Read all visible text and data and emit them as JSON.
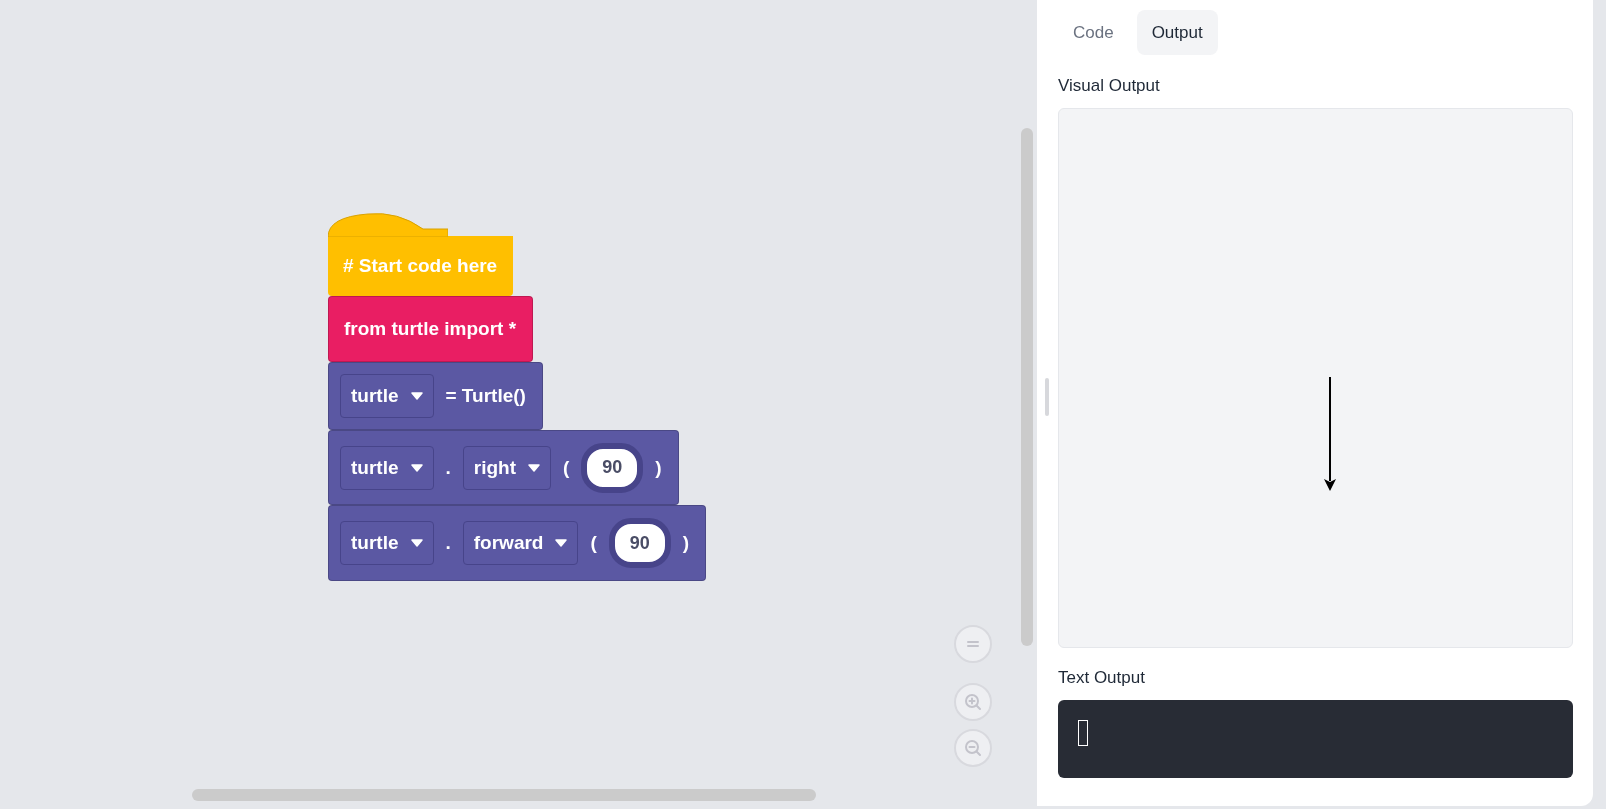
{
  "workspace": {
    "blocks": [
      {
        "kind": "hat",
        "color": "#ffbf00",
        "parts": [
          {
            "kind": "text",
            "text": "# Start code here"
          }
        ]
      },
      {
        "kind": "statement",
        "color": "#e91e63",
        "parts": [
          {
            "kind": "text",
            "text": "from turtle import *"
          }
        ]
      },
      {
        "kind": "statement",
        "color": "#5b58a3",
        "parts": [
          {
            "kind": "dropdown",
            "text": "turtle"
          },
          {
            "kind": "text",
            "text": "= Turtle()"
          }
        ]
      },
      {
        "kind": "statement",
        "color": "#5b58a3",
        "parts": [
          {
            "kind": "dropdown",
            "text": "turtle"
          },
          {
            "kind": "text",
            "text": "."
          },
          {
            "kind": "dropdown",
            "text": "right"
          },
          {
            "kind": "text",
            "text": "("
          },
          {
            "kind": "number",
            "text": "90"
          },
          {
            "kind": "text",
            "text": ")"
          }
        ]
      },
      {
        "kind": "statement",
        "color": "#5b58a3",
        "parts": [
          {
            "kind": "dropdown",
            "text": "turtle"
          },
          {
            "kind": "text",
            "text": "."
          },
          {
            "kind": "dropdown",
            "text": "forward"
          },
          {
            "kind": "text",
            "text": "("
          },
          {
            "kind": "number",
            "text": "90"
          },
          {
            "kind": "text",
            "text": ")"
          }
        ]
      }
    ]
  },
  "tabs": [
    {
      "label": "Code",
      "selected": false
    },
    {
      "label": "Output",
      "selected": true
    }
  ],
  "visual_output": {
    "label": "Visual Output"
  },
  "text_output": {
    "label": "Text Output"
  }
}
